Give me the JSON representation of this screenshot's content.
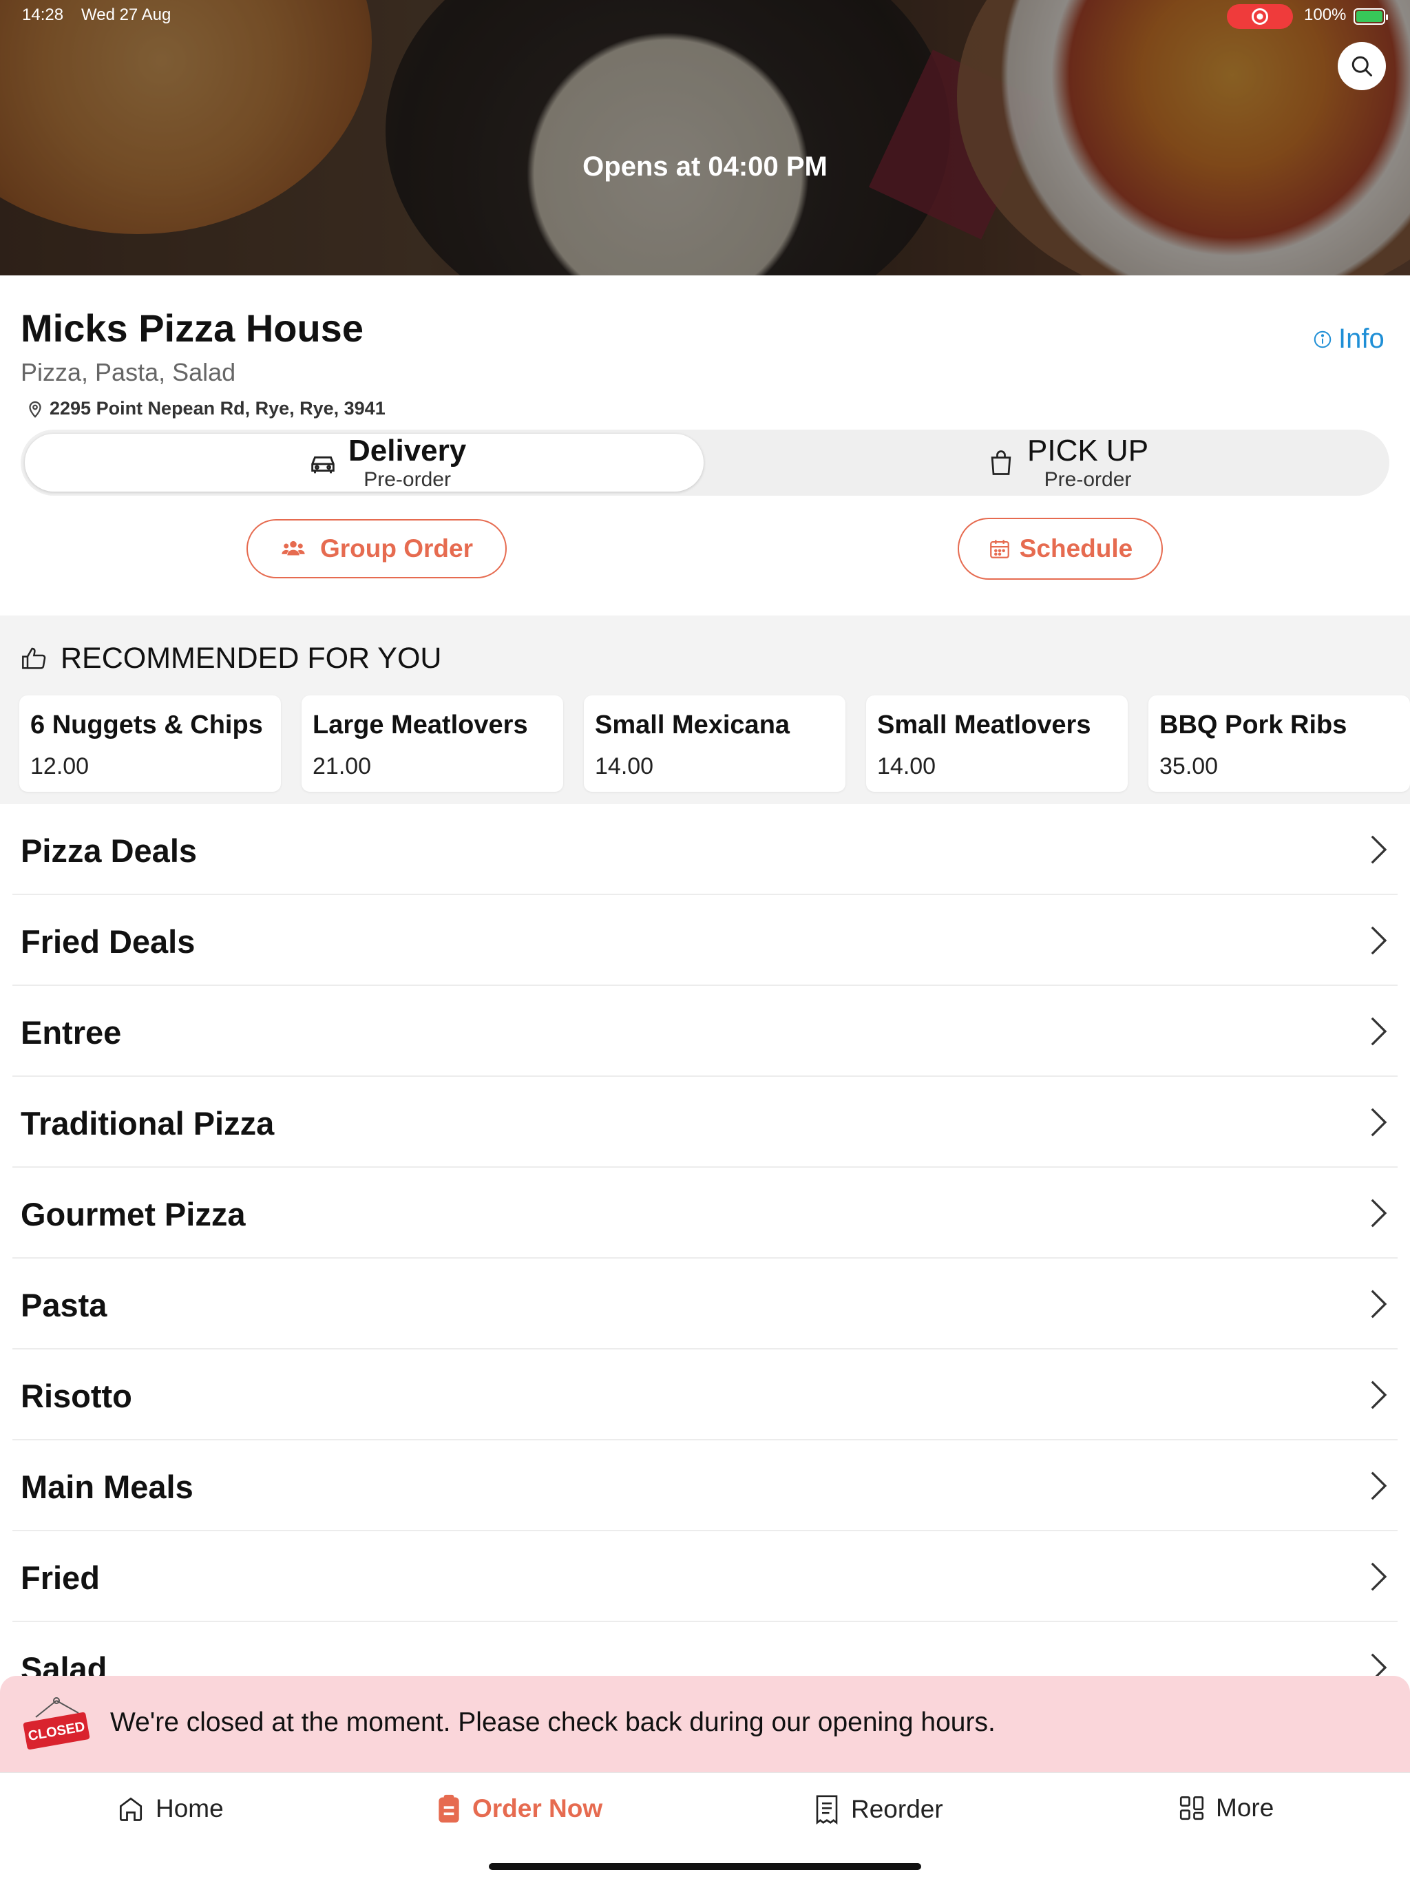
{
  "status_bar": {
    "time": "14:28",
    "date": "Wed 27 Aug",
    "battery": "100%"
  },
  "hero": {
    "opens_text": "Opens at 04:00 PM"
  },
  "restaurant": {
    "name": "Micks Pizza House",
    "cuisine": "Pizza, Pasta, Salad",
    "address": "2295 Point Nepean Rd, Rye, Rye, 3941",
    "info_label": "Info"
  },
  "modes": {
    "delivery": {
      "title": "Delivery",
      "sub": "Pre-order"
    },
    "pickup": {
      "title": "PICK UP",
      "sub": "Pre-order"
    }
  },
  "actions": {
    "group_order": "Group Order",
    "schedule": "Schedule"
  },
  "recommended": {
    "title": "RECOMMENDED FOR YOU",
    "items": [
      {
        "name": "6 Nuggets & Chips",
        "price": "12.00"
      },
      {
        "name": "Large Meatlovers",
        "price": "21.00"
      },
      {
        "name": "Small Mexicana",
        "price": "14.00"
      },
      {
        "name": "Small Meatlovers",
        "price": "14.00"
      },
      {
        "name": "BBQ Pork Ribs",
        "price": "35.00"
      }
    ]
  },
  "categories": [
    "Pizza Deals",
    "Fried Deals",
    "Entree",
    "Traditional Pizza",
    "Gourmet Pizza",
    "Pasta",
    "Risotto",
    "Main Meals",
    "Fried",
    "Salad"
  ],
  "closed_banner": {
    "sign": "CLOSED",
    "message": "We're closed at the moment. Please check back during our opening hours."
  },
  "tabbar": {
    "home": "Home",
    "order_now": "Order Now",
    "reorder": "Reorder",
    "more": "More"
  },
  "colors": {
    "accent": "#e66b50",
    "info": "#1f8fd6",
    "banner_bg": "#fad6da",
    "closed_red": "#d9232e"
  }
}
